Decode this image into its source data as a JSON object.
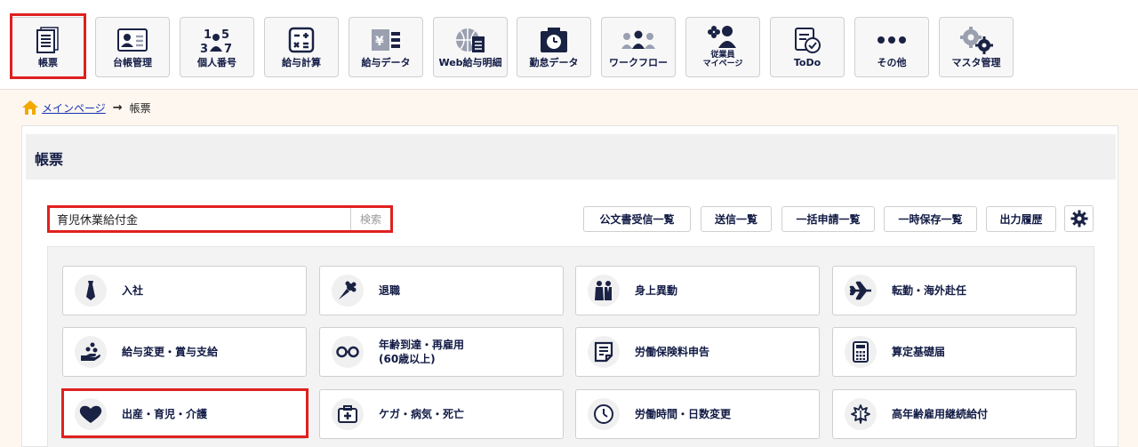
{
  "nav": [
    {
      "label": "帳票",
      "icon": "document-list-icon"
    },
    {
      "label": "台帳管理",
      "icon": "id-card-icon"
    },
    {
      "label": "個人番号",
      "icon": "numbers-icon"
    },
    {
      "label": "給与計算",
      "icon": "calculator-icon"
    },
    {
      "label": "給与データ",
      "icon": "yen-data-icon"
    },
    {
      "label": "Web給与明細",
      "icon": "globe-document-icon"
    },
    {
      "label": "勤怠データ",
      "icon": "clock-folder-icon"
    },
    {
      "label": "ワークフロー",
      "icon": "people-flow-icon"
    },
    {
      "label": "従業員\nマイページ",
      "icon": "employee-page-icon"
    },
    {
      "label": "ToDo",
      "icon": "todo-check-icon"
    },
    {
      "label": "その他",
      "icon": "more-dots-icon"
    },
    {
      "label": "マスタ管理",
      "icon": "gears-icon"
    }
  ],
  "breadcrumb": {
    "home": "メインページ",
    "current": "帳票"
  },
  "panel": {
    "title": "帳票"
  },
  "search": {
    "value": "育児休業給付金",
    "button": "検索"
  },
  "toolbar": {
    "buttons": [
      "公文書受信一覧",
      "送信一覧",
      "一括申請一覧",
      "一時保存一覧",
      "出力履歴"
    ],
    "settings_icon": "gear-icon"
  },
  "tiles": [
    {
      "label": "入社",
      "icon": "necktie-icon"
    },
    {
      "label": "退職",
      "icon": "bouquet-icon"
    },
    {
      "label": "身上異動",
      "icon": "wedding-couple-icon"
    },
    {
      "label": "転勤・海外赴任",
      "icon": "airplane-icon"
    },
    {
      "label": "給与変更・賞与支給",
      "icon": "hand-coins-icon"
    },
    {
      "label": "年齢到達・再雇用\n(60歳以上)",
      "icon": "glasses-icon"
    },
    {
      "label": "労働保険料申告",
      "icon": "report-document-icon"
    },
    {
      "label": "算定基礎届",
      "icon": "calculator-icon"
    },
    {
      "label": "出産・育児・介護",
      "icon": "heart-icon"
    },
    {
      "label": "ケガ・病気・死亡",
      "icon": "first-aid-kit-icon"
    },
    {
      "label": "労働時間・日数変更",
      "icon": "clock-icon"
    },
    {
      "label": "高年齢雇用継続給付",
      "icon": "leaf-emblem-icon"
    }
  ],
  "colors": {
    "highlight": "#e02020",
    "navy": "#111a44",
    "link": "#1a33b0",
    "page_bg": "#fdf7f0"
  }
}
